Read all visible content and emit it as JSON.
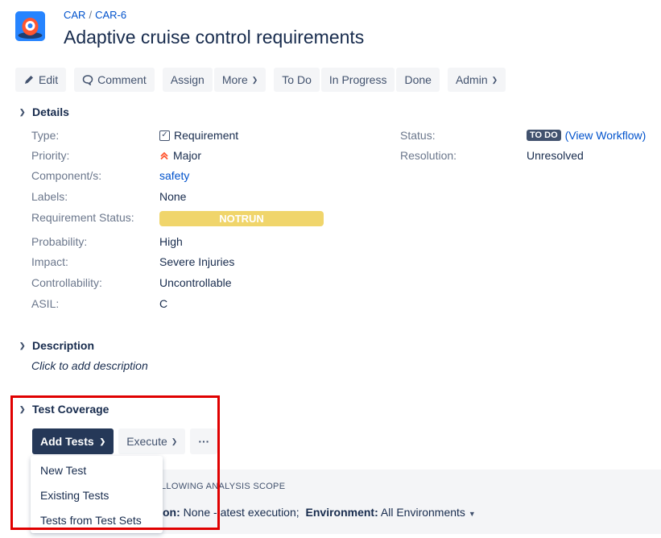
{
  "header": {
    "breadcrumb_project": "CAR",
    "breadcrumb_separator": "/",
    "breadcrumb_issue": "CAR-6",
    "title": "Adaptive cruise control requirements"
  },
  "toolbar": {
    "edit": "Edit",
    "comment": "Comment",
    "assign": "Assign",
    "more": "More",
    "todo": "To Do",
    "in_progress": "In Progress",
    "done": "Done",
    "admin": "Admin"
  },
  "details": {
    "heading": "Details",
    "type_label": "Type:",
    "type_value": "Requirement",
    "priority_label": "Priority:",
    "priority_value": "Major",
    "component_label": "Component/s:",
    "component_value": "safety",
    "labels_label": "Labels:",
    "labels_value": "None",
    "req_status_label": "Requirement Status:",
    "req_status_value": "NOTRUN",
    "probability_label": "Probability:",
    "probability_value": "High",
    "impact_label": "Impact:",
    "impact_value": "Severe Injuries",
    "controllability_label": "Controllability:",
    "controllability_value": "Uncontrollable",
    "asil_label": "ASIL:",
    "asil_value": "C",
    "status_label": "Status:",
    "status_badge": "TO DO",
    "view_workflow": "(View Workflow)",
    "resolution_label": "Resolution:",
    "resolution_value": "Unresolved"
  },
  "description": {
    "heading": "Description",
    "placeholder": "Click to add description"
  },
  "test_coverage": {
    "heading": "Test Coverage",
    "add_tests": "Add Tests",
    "execute": "Execute",
    "more": "···",
    "menu": [
      "New Test",
      "Existing Tests",
      "Tests from Test Sets"
    ],
    "scope_title": "LLOWING ANALYSIS SCOPE",
    "scope_prefix": "on:",
    "scope_version": "None - ",
    "scope_latest": "atest execution;",
    "scope_env_label": "Environment:",
    "scope_env_value": "All Environments"
  },
  "colors": {
    "accent": "#0052cc",
    "notrun": "#f0d56b",
    "primary_button": "#253858",
    "highlight": "#e00000"
  }
}
